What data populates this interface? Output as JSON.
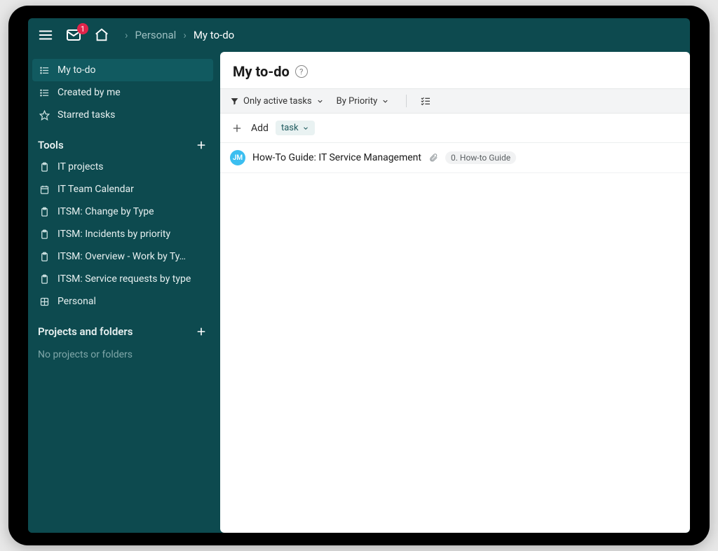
{
  "inbox_badge": "1",
  "breadcrumb": {
    "parent": "Personal",
    "current": "My to-do"
  },
  "sidebar": {
    "smart": [
      {
        "label": "My to-do",
        "icon": "list-icon",
        "active": true
      },
      {
        "label": "Created by me",
        "icon": "list-icon",
        "active": false
      },
      {
        "label": "Starred tasks",
        "icon": "star-icon",
        "active": false
      }
    ],
    "tools_title": "Tools",
    "tools": [
      {
        "label": "IT projects",
        "icon": "clipboard-icon"
      },
      {
        "label": "IT Team Calendar",
        "icon": "calendar-icon"
      },
      {
        "label": "ITSM: Change by Type",
        "icon": "clipboard-icon"
      },
      {
        "label": "ITSM: Incidents by priority",
        "icon": "clipboard-icon"
      },
      {
        "label": "ITSM: Overview - Work by Ty…",
        "icon": "clipboard-icon"
      },
      {
        "label": "ITSM: Service requests by type",
        "icon": "clipboard-icon"
      },
      {
        "label": "Personal",
        "icon": "grid-icon"
      }
    ],
    "projects_title": "Projects and folders",
    "projects_empty": "No projects or folders"
  },
  "main": {
    "title": "My to-do",
    "filter1": "Only active tasks",
    "filter2": "By Priority",
    "add_label": "Add",
    "add_type": "task",
    "tasks": [
      {
        "avatar": "JM",
        "title": "How-To Guide: IT Service Management",
        "tag": "0. How-to Guide"
      }
    ]
  }
}
